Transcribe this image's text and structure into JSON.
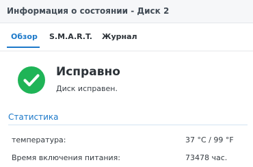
{
  "window": {
    "title": "Информация о состоянии - Диск 2"
  },
  "tabs": [
    {
      "label": "Обзор",
      "active": true
    },
    {
      "label": "S.M.A.R.T.",
      "active": false
    },
    {
      "label": "Журнал",
      "active": false
    }
  ],
  "status": {
    "icon": "check-circle-icon",
    "color": "#1fb457",
    "title": "Исправно",
    "description": "Диск исправен."
  },
  "statistics": {
    "heading": "Статистика",
    "rows": [
      {
        "label": "температура:",
        "value": "37 °C / 99 °F"
      },
      {
        "label": "Время включения питания:",
        "value": "73478 час."
      }
    ]
  },
  "colors": {
    "accent": "#1b78c9",
    "header_bg": "#f6f7f9"
  }
}
